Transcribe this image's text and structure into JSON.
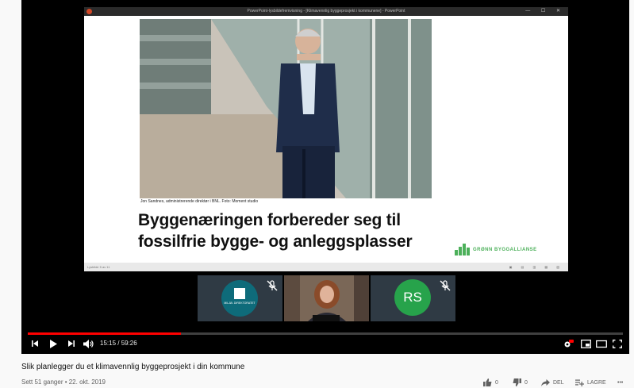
{
  "ppt": {
    "window_title": "PowerPoint-lysbildefremvisning - [Klimavennlig byggeprosjekt i kommunene] - PowerPoint",
    "window_buttons": "— ☐ ✕",
    "status_left": "Lysbilde 5 av 11",
    "status_right": "▣ ▤ ▥ ▦ ▧"
  },
  "slide": {
    "photo_caption": "Jon Sandnes, administrerende direktør i BNL. Foto: Moment studio",
    "headline_line1": "Byggenæringen forbereder seg til",
    "headline_line2": "fossilfrie bygge- og anleggsplasser",
    "logo_text": "GRØNN BYGGALLIANSE"
  },
  "participants": [
    {
      "name": "miljodirektoratet-tile",
      "logo_text": "MILJØ- DIREKTORATET",
      "muted": true
    },
    {
      "name": "presenter-video-tile",
      "muted": false
    },
    {
      "name": "rs-tile",
      "initials": "RS",
      "muted": true
    }
  ],
  "player": {
    "time_display": "15:15 / 59:26",
    "progress_fraction": 0.257
  },
  "video": {
    "title": "Slik planlegger du et klimavennlig byggeprosjekt i din kommune",
    "meta": "Sett 51 ganger • 22. okt. 2019",
    "likes": "0",
    "dislikes": "0",
    "share_label": "DEL",
    "save_label": "LAGRE",
    "more_label": "•••"
  },
  "colors": {
    "progress": "#ff0000",
    "brand_green": "#4cb05a",
    "rs_avatar": "#27a34b",
    "miljo_logo": "#0e6b7a"
  }
}
